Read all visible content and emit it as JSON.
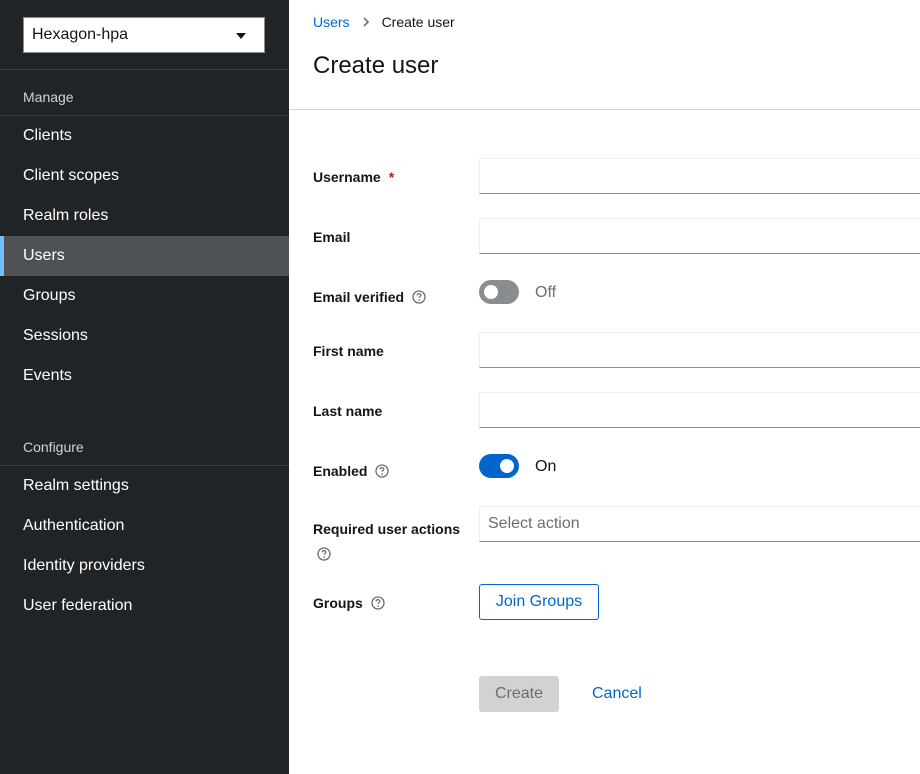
{
  "sidebar": {
    "realm_selector": "Hexagon-hpa",
    "manage_title": "Manage",
    "manage_items": [
      {
        "label": "Clients"
      },
      {
        "label": "Client scopes"
      },
      {
        "label": "Realm roles"
      },
      {
        "label": "Users",
        "active": true
      },
      {
        "label": "Groups"
      },
      {
        "label": "Sessions"
      },
      {
        "label": "Events"
      }
    ],
    "configure_title": "Configure",
    "configure_items": [
      {
        "label": "Realm settings"
      },
      {
        "label": "Authentication"
      },
      {
        "label": "Identity providers"
      },
      {
        "label": "User federation"
      }
    ]
  },
  "breadcrumb": {
    "parent": "Users",
    "current": "Create user"
  },
  "page_title": "Create user",
  "form": {
    "username_label": "Username",
    "username_required_marker": "*",
    "username_value": "",
    "email_label": "Email",
    "email_value": "",
    "email_verified_label": "Email verified",
    "email_verified_state": "Off",
    "first_name_label": "First name",
    "first_name_value": "",
    "last_name_label": "Last name",
    "last_name_value": "",
    "enabled_label": "Enabled",
    "enabled_state": "On",
    "required_actions_label": "Required user actions",
    "required_actions_placeholder": "Select action",
    "groups_label": "Groups",
    "join_groups_button": "Join Groups"
  },
  "actions": {
    "create": "Create",
    "cancel": "Cancel"
  },
  "colors": {
    "sidebar_bg": "#212427",
    "active_item_bg": "#4f5255",
    "active_indicator": "#73bcf7",
    "link": "#0066cc",
    "required": "#c9190b"
  }
}
